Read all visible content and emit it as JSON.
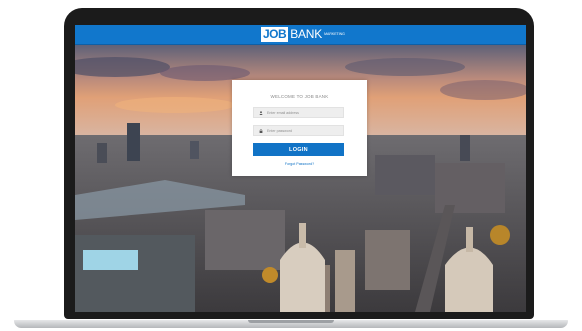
{
  "header": {
    "logo": {
      "job": "JOB",
      "bank": "BANK",
      "marketing": "MARKETING"
    }
  },
  "login": {
    "welcome": "WELCOME TO JOB BANK",
    "email_placeholder": "Enter email address",
    "password_placeholder": "Enter password",
    "button_label": "LOGIN",
    "forgot_label": "Forgot Password?"
  },
  "icons": {
    "email": "person-icon",
    "password": "lock-icon"
  },
  "colors": {
    "brand_blue": "#1177cc",
    "button_blue": "#1173c6",
    "card_white": "#ffffff"
  }
}
